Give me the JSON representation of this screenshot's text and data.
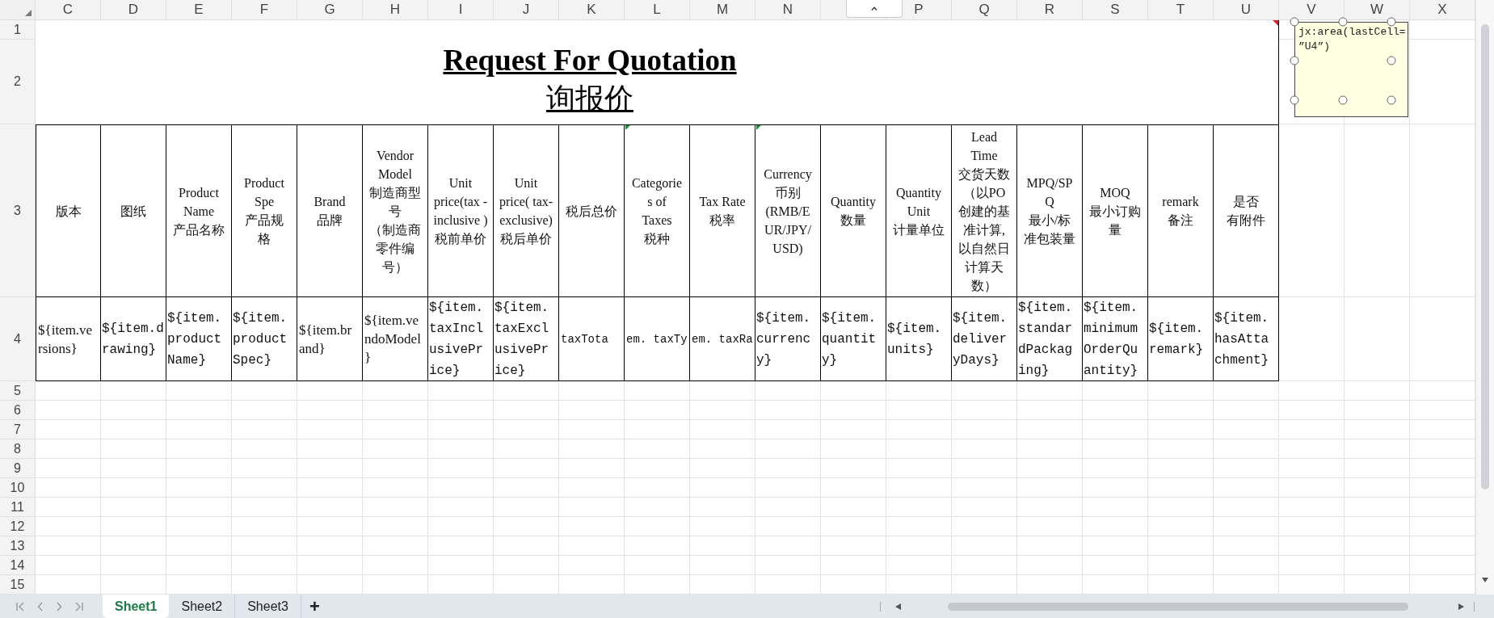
{
  "column_headers": [
    {
      "letter": "C"
    },
    {
      "letter": "D"
    },
    {
      "letter": "E"
    },
    {
      "letter": "F"
    },
    {
      "letter": "G"
    },
    {
      "letter": "H"
    },
    {
      "letter": "I"
    },
    {
      "letter": "J"
    },
    {
      "letter": "K"
    },
    {
      "letter": "L"
    },
    {
      "letter": "M"
    },
    {
      "letter": "N"
    },
    {
      "kind": "covered"
    },
    {
      "letter": "P"
    },
    {
      "letter": "Q"
    },
    {
      "letter": "R"
    },
    {
      "letter": "S"
    },
    {
      "letter": "T"
    },
    {
      "letter": "U"
    },
    {
      "letter": "V"
    },
    {
      "letter": "W"
    },
    {
      "letter": "X"
    }
  ],
  "row_numbers": [
    "1",
    "2",
    "3",
    "4",
    "5",
    "6",
    "7",
    "8",
    "9",
    "10",
    "11",
    "12",
    "13",
    "14",
    "15"
  ],
  "title": {
    "english": "Request For Quotation",
    "chinese": "询报价"
  },
  "header_cells": [
    {
      "lines": [
        "版本"
      ],
      "flagged": false
    },
    {
      "lines": [
        "图纸"
      ],
      "flagged": false
    },
    {
      "lines": [
        "Product",
        "Name",
        "产品名称"
      ],
      "flagged": false
    },
    {
      "lines": [
        "Product",
        "Spe",
        "产品规",
        "格"
      ],
      "flagged": false
    },
    {
      "lines": [
        "Brand",
        "品牌"
      ],
      "flagged": false
    },
    {
      "lines": [
        "Vendor",
        "Model",
        "制造商型",
        "号",
        "（制造商",
        "零件编",
        "号）"
      ],
      "flagged": false
    },
    {
      "lines": [
        "Unit",
        "price(tax -",
        "inclusive )",
        "税前单价"
      ],
      "flagged": false
    },
    {
      "lines": [
        "Unit",
        "price( tax-",
        "exclusive)",
        "税后单价"
      ],
      "flagged": false
    },
    {
      "lines": [
        "税后总价"
      ],
      "flagged": false
    },
    {
      "lines": [
        "Categorie",
        "s of",
        "Taxes",
        "税种"
      ],
      "flagged": true
    },
    {
      "lines": [
        "Tax  Rate",
        "税率"
      ],
      "flagged": false
    },
    {
      "lines": [
        "Currency",
        "币别",
        "(RMB/E",
        "UR/JPY/",
        "USD)"
      ],
      "flagged": true
    },
    {
      "lines": [
        "Quantity",
        "数量"
      ],
      "flagged": false
    },
    {
      "lines": [
        "Quantity",
        "Unit",
        "计量单位"
      ],
      "flagged": false
    },
    {
      "lines": [
        "Lead",
        "Time",
        "交货天数",
        "（以PO",
        "创建的基",
        "准计算,",
        "以自然日",
        "计算天",
        "数）"
      ],
      "flagged": false
    },
    {
      "lines": [
        "MPQ/SP",
        "Q",
        "最小/标",
        "准包装量"
      ],
      "flagged": false
    },
    {
      "lines": [
        "MOQ",
        "最小订购",
        "量"
      ],
      "flagged": false
    },
    {
      "lines": [
        "remark",
        "备注"
      ],
      "flagged": false
    },
    {
      "lines": [
        "是否",
        "有附件"
      ],
      "flagged": false
    }
  ],
  "template_cells": [
    {
      "kind": "plain",
      "lines": [
        "${item.ve",
        "rsions}"
      ]
    },
    {
      "kind": "code",
      "lines": [
        "${item.d",
        "rawing}"
      ]
    },
    {
      "kind": "code",
      "lines": [
        "${item.",
        "product",
        "Name}"
      ]
    },
    {
      "kind": "code",
      "lines": [
        "${item.",
        "product",
        "Spec}"
      ]
    },
    {
      "kind": "plain",
      "lines": [
        "${item.br",
        "and}"
      ]
    },
    {
      "kind": "plain",
      "lines": [
        "${item.ve",
        "ndoModel",
        "}"
      ]
    },
    {
      "kind": "code",
      "lines": [
        "${item.",
        "taxIncl",
        "usivePr",
        "ice}"
      ]
    },
    {
      "kind": "code",
      "lines": [
        "${item.",
        "taxExcl",
        "usivePr",
        "ice}"
      ]
    },
    {
      "kind": "code",
      "lines": [
        "taxTota"
      ]
    },
    {
      "kind": "code",
      "lines": [
        "em. taxTy"
      ]
    },
    {
      "kind": "code",
      "lines": [
        "em. taxRa"
      ]
    },
    {
      "kind": "code",
      "lines": [
        "${item.",
        "currenc",
        "y}"
      ]
    },
    {
      "kind": "code",
      "lines": [
        "${item.",
        "quantit",
        "y}"
      ]
    },
    {
      "kind": "code",
      "lines": [
        "${item.",
        "units}"
      ]
    },
    {
      "kind": "code",
      "lines": [
        "${item.",
        "deliver",
        "yDays}"
      ]
    },
    {
      "kind": "code",
      "lines": [
        "${item.",
        "standar",
        "dPackag",
        "ing}"
      ]
    },
    {
      "kind": "code",
      "lines": [
        "${item.",
        "minimum",
        "OrderQu",
        "antity}"
      ]
    },
    {
      "kind": "code",
      "lines": [
        "${item.",
        "remark}"
      ]
    },
    {
      "kind": "code",
      "lines": [
        "${item.",
        "hasAtta",
        "chment}"
      ]
    }
  ],
  "note": {
    "lines": [
      "jx:area(lastCell=",
      "”U4”)"
    ]
  },
  "sheet_tabs": [
    {
      "label": "Sheet1",
      "selected": true
    },
    {
      "label": "Sheet2",
      "selected": false
    },
    {
      "label": "Sheet3",
      "selected": false
    }
  ],
  "add_sheet_button": {
    "label": "+"
  }
}
